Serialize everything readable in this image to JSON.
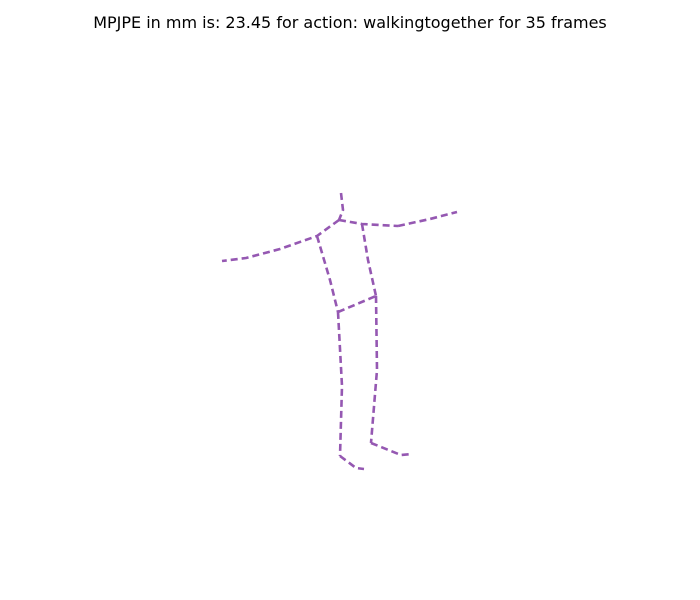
{
  "figure": {
    "title": "MPJPE in mm is: 23.45 for action: walkingtogether for 35 frames"
  },
  "style": {
    "background": "#ffffff",
    "skeleton_color": "#9558b2",
    "line_style": "dashed"
  }
}
